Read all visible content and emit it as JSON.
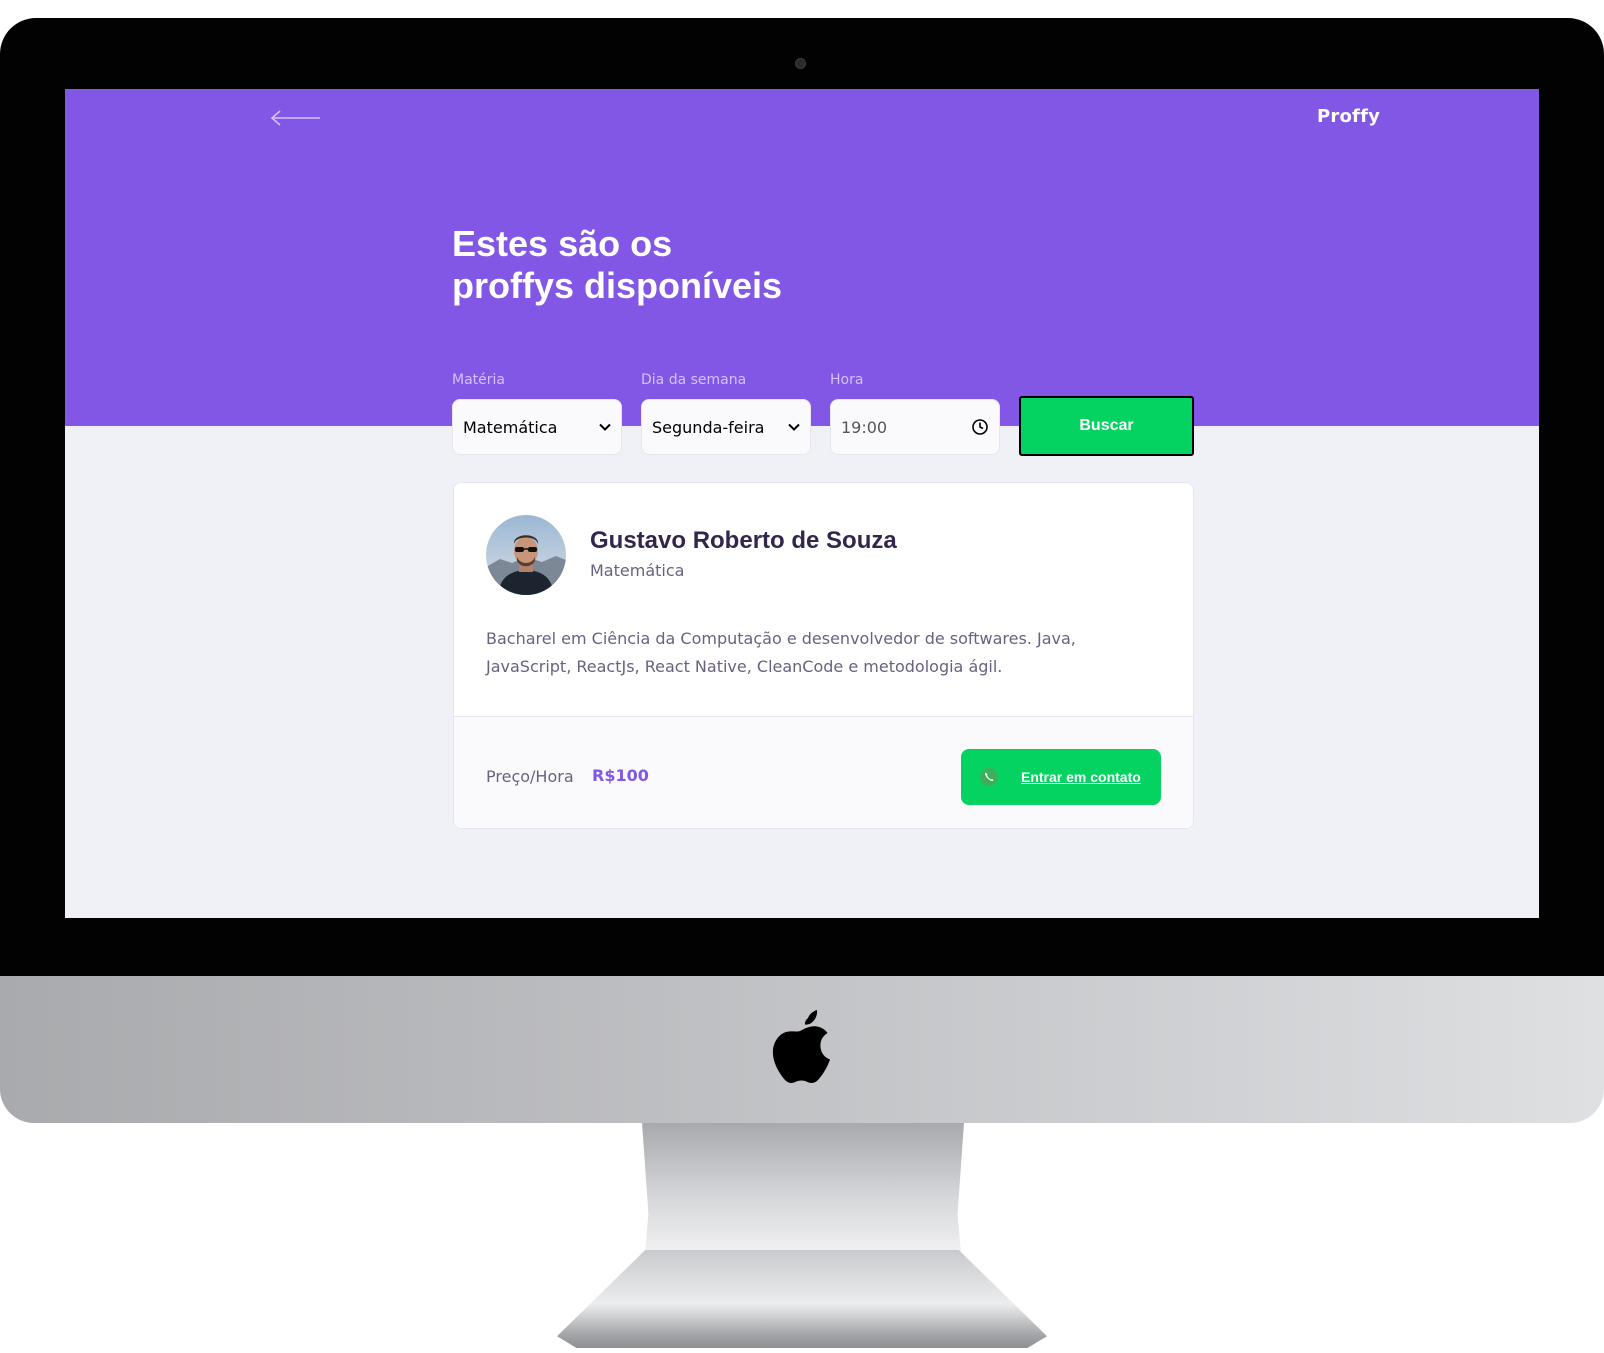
{
  "header": {
    "brand": "Proffy",
    "title_line1": "Estes são os",
    "title_line2": "proffys disponíveis"
  },
  "filters": {
    "subject": {
      "label": "Matéria",
      "value": "Matemática"
    },
    "weekday": {
      "label": "Dia da semana",
      "value": "Segunda-feira"
    },
    "time": {
      "label": "Hora",
      "value": "19:00"
    },
    "search_label": "Buscar"
  },
  "teacher": {
    "name": "Gustavo Roberto de Souza",
    "subject": "Matemática",
    "bio": "Bacharel em Ciência da Computação e desenvolvedor de softwares. Java, JavaScript, ReactJs, React Native, CleanCode e metodologia ágil.",
    "price_label": "Preço/Hora",
    "price_value": "R$100",
    "contact_label": "Entrar em contato"
  },
  "icons": {
    "back": "arrow-left-icon",
    "chevron": "chevron-down-icon",
    "clock": "clock-icon",
    "whatsapp": "whatsapp-icon",
    "apple": "apple-logo"
  },
  "colors": {
    "primary": "#8257e5",
    "secondary": "#04d361",
    "background": "#f0f0f7",
    "title_text": "#32264d",
    "body_text": "#6a6180"
  }
}
